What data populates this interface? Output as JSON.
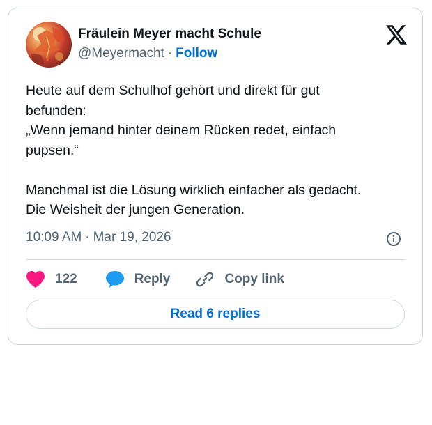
{
  "author": {
    "name": "Fräulein Meyer macht Schule",
    "handle": "@Meyermacht",
    "separator": "·",
    "follow_label": "Follow"
  },
  "tweet": {
    "lines": [
      "Heute auf dem Schulhof gehört und direkt für gut",
      "befunden:",
      "„Wenn jemand hinter deinem Rücken redet, einfach",
      "pupsen.“",
      "",
      "Manchmal ist die Lösung wirklich einfacher als gedacht.",
      "Die Weisheit der jungen Generation."
    ]
  },
  "meta": {
    "time": "10:09 AM",
    "separator": "·",
    "date": "Mar 19, 2026"
  },
  "actions": {
    "likes_count": "122",
    "reply_label": "Reply",
    "copy_link_label": "Copy link"
  },
  "read_replies_label": "Read 6 replies",
  "icons": {
    "brand": "x-logo-icon",
    "info": "info-icon",
    "like": "heart-icon",
    "reply": "speech-bubble-icon",
    "copy": "link-icon"
  },
  "colors": {
    "like_pink": "#f91880",
    "reply_blue": "#1d9bf0",
    "link_blue": "#006fd6",
    "secondary_text": "#536471",
    "border": "#cfd9de"
  }
}
